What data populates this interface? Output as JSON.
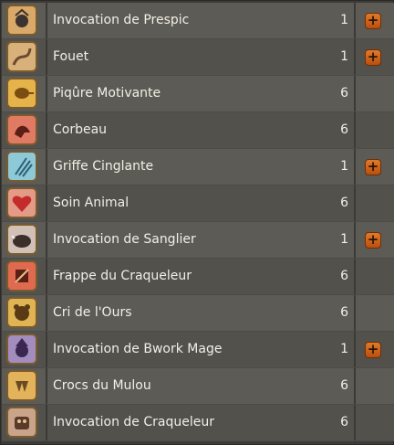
{
  "spells": [
    {
      "name": "Invocation de Prespic",
      "level": "1",
      "upgradable": true,
      "icon": "prespic-icon",
      "bg": "#d9a96a",
      "fg": "#3a3330"
    },
    {
      "name": "Fouet",
      "level": "1",
      "upgradable": true,
      "icon": "whip-icon",
      "bg": "#d8b07a",
      "fg": "#6b4a2e"
    },
    {
      "name": "Piqûre Motivante",
      "level": "6",
      "upgradable": false,
      "icon": "sting-icon",
      "bg": "#e6b24a",
      "fg": "#7a4d12"
    },
    {
      "name": "Corbeau",
      "level": "6",
      "upgradable": false,
      "icon": "crow-icon",
      "bg": "#e07a62",
      "fg": "#5a1f16"
    },
    {
      "name": "Griffe Cinglante",
      "level": "1",
      "upgradable": true,
      "icon": "claw-icon",
      "bg": "#8ec9d8",
      "fg": "#2d5f73"
    },
    {
      "name": "Soin Animal",
      "level": "6",
      "upgradable": false,
      "icon": "heart-icon",
      "bg": "#e39a86",
      "fg": "#c42b2b"
    },
    {
      "name": "Invocation de Sanglier",
      "level": "1",
      "upgradable": true,
      "icon": "boar-icon",
      "bg": "#d1c0b6",
      "fg": "#3b2f2b"
    },
    {
      "name": "Frappe du Craqueleur",
      "level": "6",
      "upgradable": false,
      "icon": "craqueleur-strike-icon",
      "bg": "#e06a4f",
      "fg": "#5a2015"
    },
    {
      "name": "Cri de l'Ours",
      "level": "6",
      "upgradable": false,
      "icon": "bear-icon",
      "bg": "#e0b355",
      "fg": "#5a3a15"
    },
    {
      "name": "Invocation de Bwork Mage",
      "level": "1",
      "upgradable": true,
      "icon": "bwork-mage-icon",
      "bg": "#a38dbf",
      "fg": "#3a2750"
    },
    {
      "name": "Crocs du Mulou",
      "level": "6",
      "upgradable": false,
      "icon": "fangs-icon",
      "bg": "#e2b35a",
      "fg": "#6a4a22"
    },
    {
      "name": "Invocation de Craqueleur",
      "level": "6",
      "upgradable": false,
      "icon": "craqueleur-icon",
      "bg": "#c9a48a",
      "fg": "#5a3b2b"
    }
  ],
  "upgrade_label": "+",
  "colors": {
    "accent": "#d0621c",
    "row_light": "#5d5b55",
    "row_dark": "#53514c",
    "text": "#f2efe6"
  }
}
